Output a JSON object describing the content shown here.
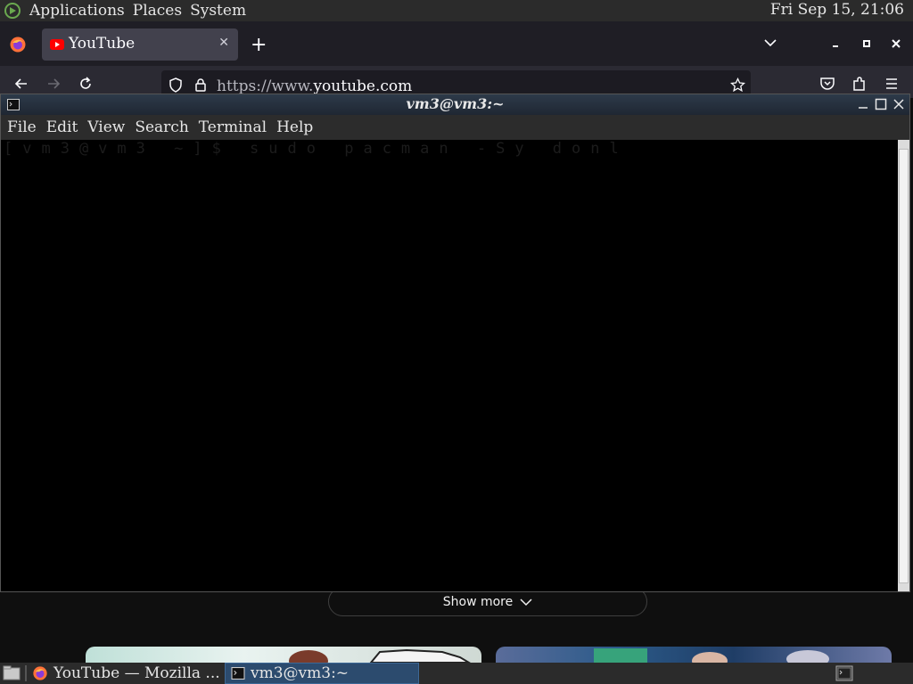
{
  "top_panel": {
    "menus": [
      "Applications",
      "Places",
      "System"
    ],
    "clock": "Fri Sep 15, 21:06"
  },
  "firefox": {
    "tab_title": "YouTube",
    "url_prefix": "https://www.",
    "url_domain": "youtube.com"
  },
  "youtube": {
    "show_more_label": "Show more"
  },
  "terminal": {
    "title": "vm3@vm3:~",
    "menus": [
      "File",
      "Edit",
      "View",
      "Search",
      "Terminal",
      "Help"
    ],
    "line": "[vm3@vm3 ~]$ sudo pacman -Sy donl"
  },
  "taskbar": {
    "firefox_task": "YouTube — Mozilla ...",
    "terminal_task": "vm3@vm3:~"
  },
  "colors": {
    "panel_bg": "#2b2b2b",
    "terminal_bg": "#000000",
    "active_task": "#2c4b6e"
  }
}
